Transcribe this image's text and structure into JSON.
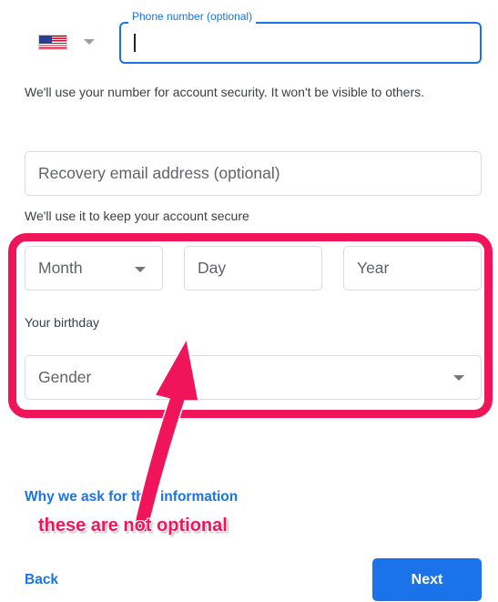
{
  "phone": {
    "label": "Phone number (optional)",
    "value": "",
    "country_icon": "us-flag-icon",
    "helper": "We'll use your number for account security. It won't be visible to others."
  },
  "recovery": {
    "placeholder": "Recovery email address (optional)",
    "helper": "We'll use it to keep your account secure"
  },
  "birthday": {
    "month_placeholder": "Month",
    "day_placeholder": "Day",
    "year_placeholder": "Year",
    "helper": "Your birthday"
  },
  "gender": {
    "placeholder": "Gender"
  },
  "why_link": "Why we ask for this information",
  "annotation": "these are not optional",
  "annotation_color": "#f0145a",
  "footer": {
    "back_label": "Back",
    "next_label": "Next"
  },
  "accent_color": "#1a73e8"
}
